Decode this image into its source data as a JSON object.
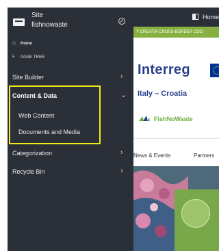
{
  "sidebar": {
    "site_label": "Site",
    "site_name": "fishnowaste",
    "home_label": "Home",
    "page_tree_label": "PAGE TREE",
    "categories": [
      {
        "label": "Site Builder",
        "chevron": "›"
      },
      {
        "label": "Content & Data",
        "chevron": "⌄"
      },
      {
        "label": "Categorization",
        "chevron": "›"
      },
      {
        "label": "Recycle Bin",
        "chevron": "›"
      }
    ],
    "content_items": [
      "Web Content",
      "Documents and Media"
    ],
    "highlight_color": "#f2ea17",
    "background_color": "#2b2f38"
  },
  "page": {
    "topbar_title": "Home",
    "banner_text": "Y CROATIA CROSS-BORDER COO",
    "logo_text": "Interreg",
    "subtitle": "Italy – Croatia",
    "project_name": "FishNoWaste",
    "nav_items": [
      "News & Events",
      "Partners"
    ],
    "accent_green": "#88b041",
    "brand_blue": "#2a3f8a"
  }
}
